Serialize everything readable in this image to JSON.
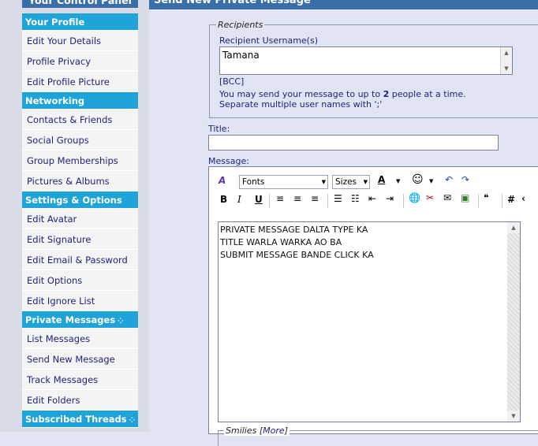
{
  "sidebar": {
    "title": "Your Control Panel",
    "sections": [
      {
        "title": "Your Profile",
        "items": [
          "Edit Your Details",
          "Profile Privacy",
          "Edit Profile Picture"
        ]
      },
      {
        "title": "Networking",
        "items": [
          "Contacts & Friends",
          "Social Groups",
          "Group Memberships",
          "Pictures & Albums"
        ]
      },
      {
        "title": "Settings & Options",
        "items": [
          "Edit Avatar",
          "Edit Signature",
          "Edit Email & Password",
          "Edit Options",
          "Edit Ignore List"
        ]
      },
      {
        "title": "Private Messages",
        "items": [
          "List Messages",
          "Send New Message",
          "Track Messages",
          "Edit Folders"
        ]
      },
      {
        "title": "Subscribed Threads",
        "items": []
      }
    ]
  },
  "main": {
    "title": "Send New Private Message",
    "recipients": {
      "legend": "Recipients",
      "label": "Recipient Username(s)",
      "value": "Tamana",
      "bcc_link": "[BCC]",
      "help_line1_pre": "You may send your message to up to ",
      "help_line1_num": "2",
      "help_line1_post": " people at a time.",
      "help_line2": "Separate multiple user names with ';'"
    },
    "title_label": "Title:",
    "title_value": "",
    "message_label": "Message:",
    "toolbar": {
      "fonts": "Fonts",
      "sizes": "Sizes",
      "bold": "B",
      "italic": "I",
      "underline": "U",
      "hash": "#"
    },
    "message_text": "PRIVATE MESSAGE DALTA TYPE KA\nTITLE WARLA WARKA AO BA\nSUBMIT MESSAGE BANDE CLICK KA",
    "smilies_legend": "Smilies",
    "smilies_more": "More"
  }
}
